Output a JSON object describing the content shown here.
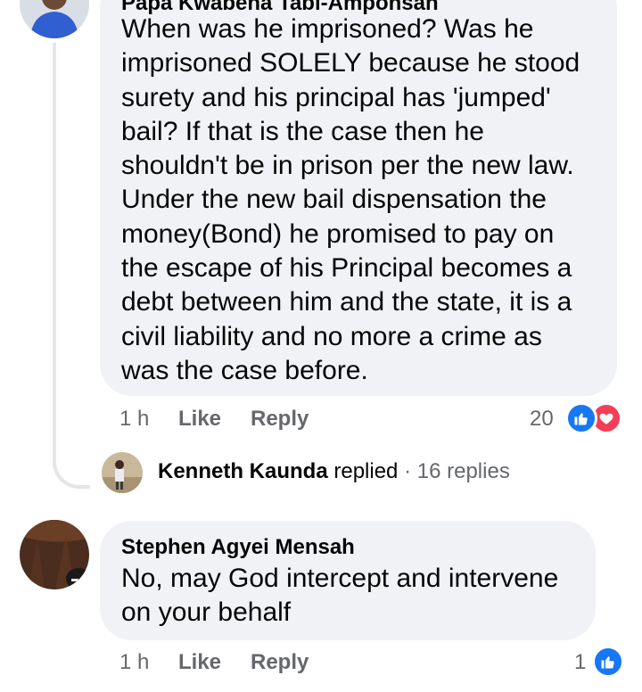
{
  "comment1": {
    "author": "Papa Kwabena Tabi-Amponsah",
    "lines": [
      "When was he imprisoned? Was he",
      "imprisoned SOLELY because he stood",
      "surety and his principal has 'jumped'",
      "bail? If that is the case then he",
      "shouldn't be in prison per the new law.",
      "Under the new bail dispensation the",
      "money(Bond) he promised to pay on",
      "the escape of his Principal becomes a",
      "debt between him and the state, it is a",
      "civil liability and no more a crime as",
      "was the case before."
    ],
    "time": "1 h",
    "like_label": "Like",
    "reply_label": "Reply",
    "reaction_count": "20",
    "reactions": [
      "like-icon",
      "love-icon"
    ],
    "reply_summary": {
      "name": "Kenneth Kaunda",
      "verb": "replied",
      "dot": "·",
      "count": "16 replies"
    }
  },
  "comment2": {
    "author": "Stephen Agyei Mensah",
    "lines": [
      "No, may God intercept and intervene",
      "on your behalf"
    ],
    "time": "1 h",
    "like_label": "Like",
    "reply_label": "Reply",
    "reaction_count": "1",
    "reactions": [
      "like-icon"
    ]
  },
  "colors": {
    "bubble": "#f0f2f5",
    "secondary_text": "#65676b",
    "like_blue": "#1877f2",
    "love_red": "#f33e58"
  }
}
